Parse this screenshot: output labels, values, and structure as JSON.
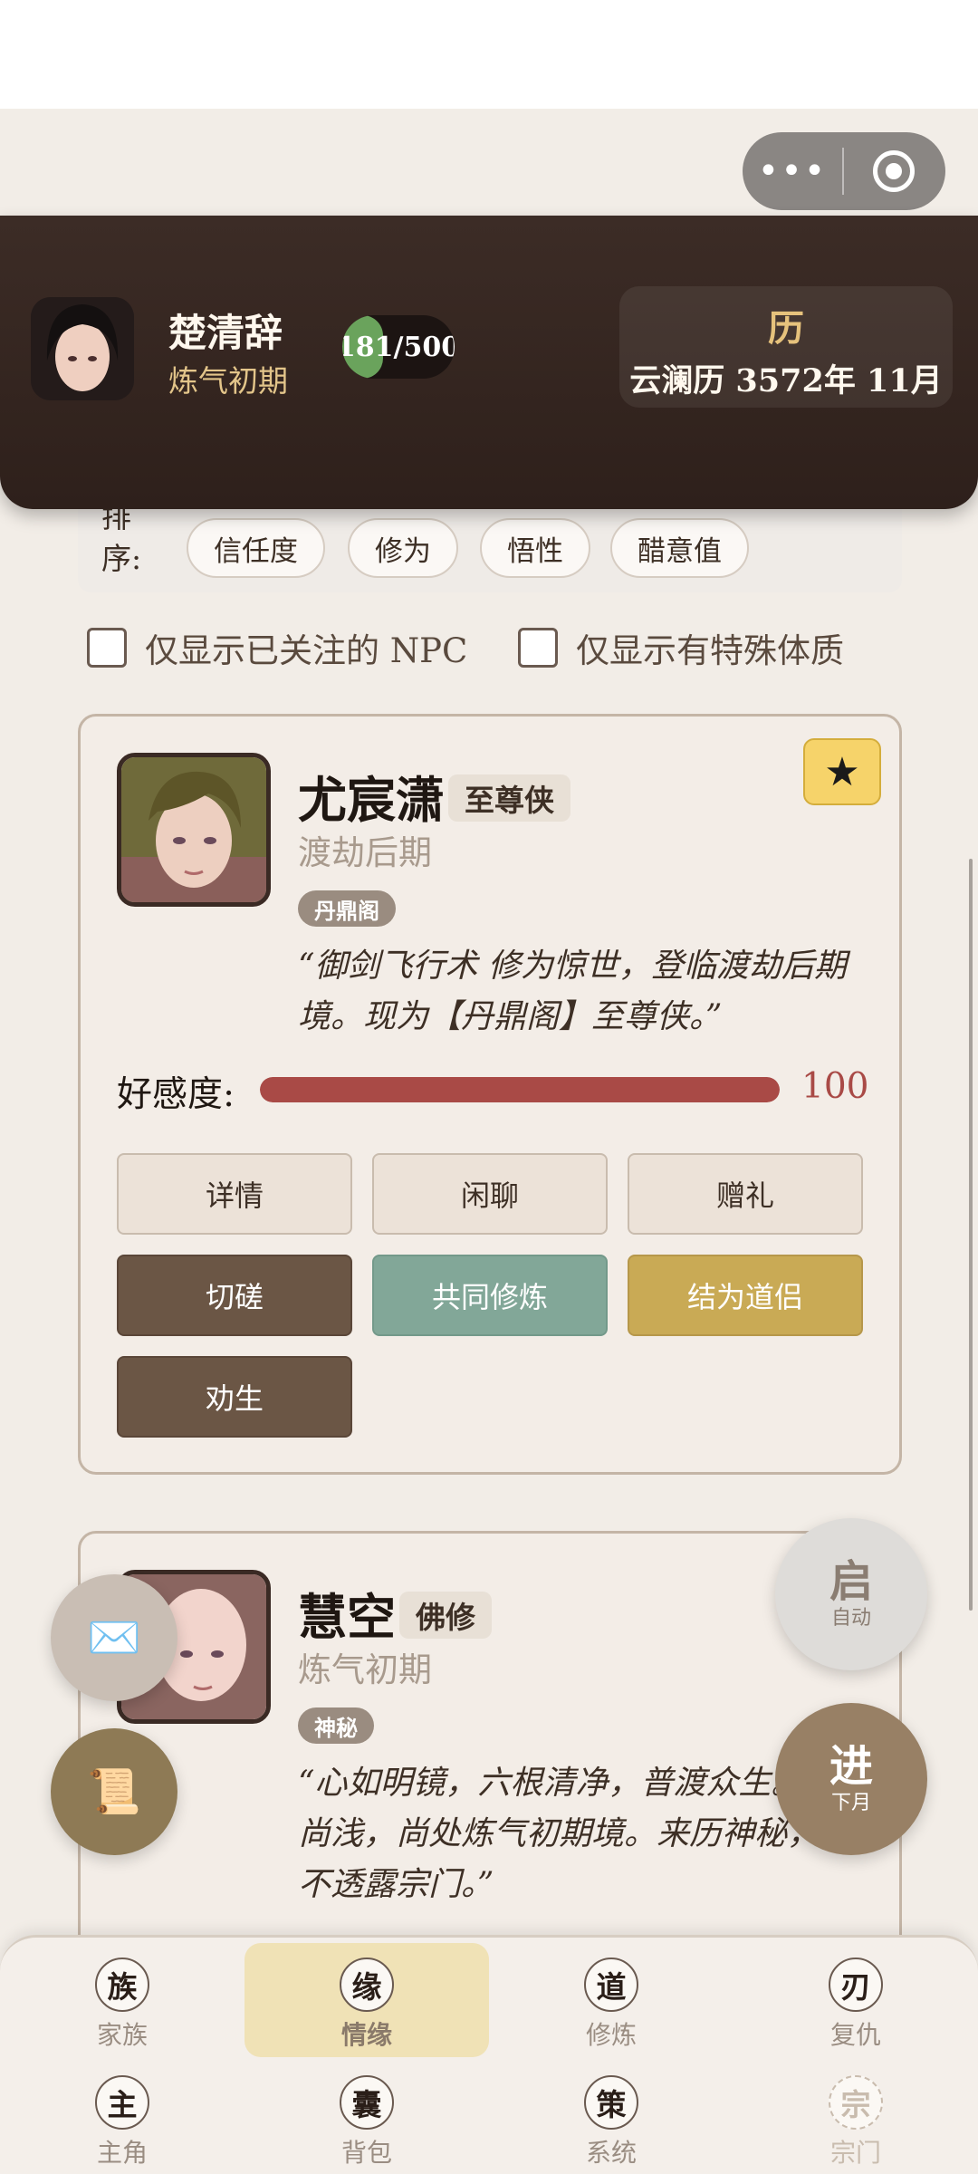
{
  "capsule": {
    "more_icon": "more-dots-icon",
    "close_icon": "target-circle-icon"
  },
  "header": {
    "player_name": "楚清辞",
    "player_realm": "炼气初期",
    "exp_text": "181/500",
    "exp_current": 181,
    "exp_max": 500,
    "calendar_title": "历",
    "calendar_date": "云澜历 3572年 11月"
  },
  "sort": {
    "label": "排序:",
    "chips": [
      "信任度",
      "修为",
      "悟性",
      "醋意值"
    ]
  },
  "filters": {
    "followed_only": "仅显示已关注的 NPC",
    "special_only": "仅显示有特殊体质"
  },
  "npcs": [
    {
      "name": "尤宸潇",
      "title": "至尊侠",
      "realm": "渡劫后期",
      "tag": "丹鼎阁",
      "quote": "“御剑飞行术 修为惊世，登临渡劫后期境。现为【丹鼎阁】至尊侠。”",
      "favorability_label": "好感度:",
      "favorability": 100,
      "favorability_max": 100,
      "favorite_icon": "star-icon",
      "favorite_glyph": "★",
      "actions": [
        "详情",
        "闲聊",
        "赠礼",
        "切磋",
        "共同修炼",
        "结为道侣",
        "劝生"
      ]
    },
    {
      "name": "慧空",
      "title": "佛修",
      "realm": "炼气初期",
      "tag": "神秘",
      "quote": "“心如明镜，六根清净，普渡众生。修为尚浅，尚处炼气初期境。来历神秘，从不透露宗门。”"
    }
  ],
  "floating": {
    "mail_glyph": "✉️",
    "scroll_glyph": "📜",
    "auto_big": "启",
    "auto_small": "自动",
    "next_big": "进",
    "next_small": "下月"
  },
  "nav": [
    {
      "glyph": "族",
      "label": "家族"
    },
    {
      "glyph": "缘",
      "label": "情缘",
      "active": true
    },
    {
      "glyph": "道",
      "label": "修炼"
    },
    {
      "glyph": "刃",
      "label": "复仇"
    },
    {
      "glyph": "主",
      "label": "主角"
    },
    {
      "glyph": "囊",
      "label": "背包"
    },
    {
      "glyph": "策",
      "label": "系统"
    },
    {
      "glyph": "宗",
      "label": "宗门",
      "disabled": true
    }
  ],
  "colors": {
    "header_bg": "#3c2c26",
    "accent_gold": "#e6c27c",
    "favor_red": "#a94a46",
    "exp_green": "#6aa35c",
    "nav_active": "#f0e2b6"
  }
}
